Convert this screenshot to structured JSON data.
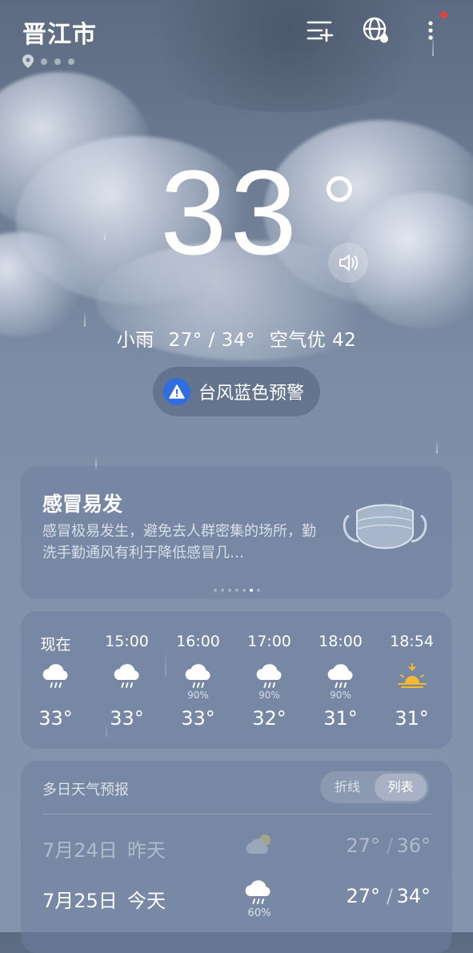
{
  "header": {
    "city": "晋江市"
  },
  "current": {
    "temp": "33",
    "condition": "小雨",
    "range": "27° / 34°",
    "air": "空气优 42"
  },
  "alert": {
    "label": "台风蓝色预警"
  },
  "tip_card": {
    "title": "感冒易发",
    "desc": "感冒极易发生，避免去人群密集的场所，勤洗手勤通风有利于降低感冒几…"
  },
  "hourly": [
    {
      "time": "现在",
      "icon": "rain-icon",
      "precip": "",
      "temp": "33°"
    },
    {
      "time": "15:00",
      "icon": "rain-icon",
      "precip": "",
      "temp": "33°"
    },
    {
      "time": "16:00",
      "icon": "rain-icon",
      "precip": "90%",
      "temp": "33°"
    },
    {
      "time": "17:00",
      "icon": "rain-icon",
      "precip": "90%",
      "temp": "32°"
    },
    {
      "time": "18:00",
      "icon": "rain-icon",
      "precip": "90%",
      "temp": "31°"
    },
    {
      "time": "18:54",
      "icon": "sunset-icon",
      "precip": "",
      "temp": "31°"
    }
  ],
  "forecast": {
    "title": "多日天气预报",
    "toggle_line": "折线",
    "toggle_list": "列表",
    "days": [
      {
        "date": "7月24日",
        "day": "昨天",
        "icon": "cloudy-sun-icon",
        "precip": "",
        "low": "27°",
        "high": "36°"
      },
      {
        "date": "7月25日",
        "day": "今天",
        "icon": "rain-icon",
        "precip": "60%",
        "low": "27°",
        "high": "34°"
      }
    ]
  },
  "colors": {
    "accent_alert": "#2f6de0",
    "notify": "#e5423a",
    "sun": "#f5b82e"
  }
}
